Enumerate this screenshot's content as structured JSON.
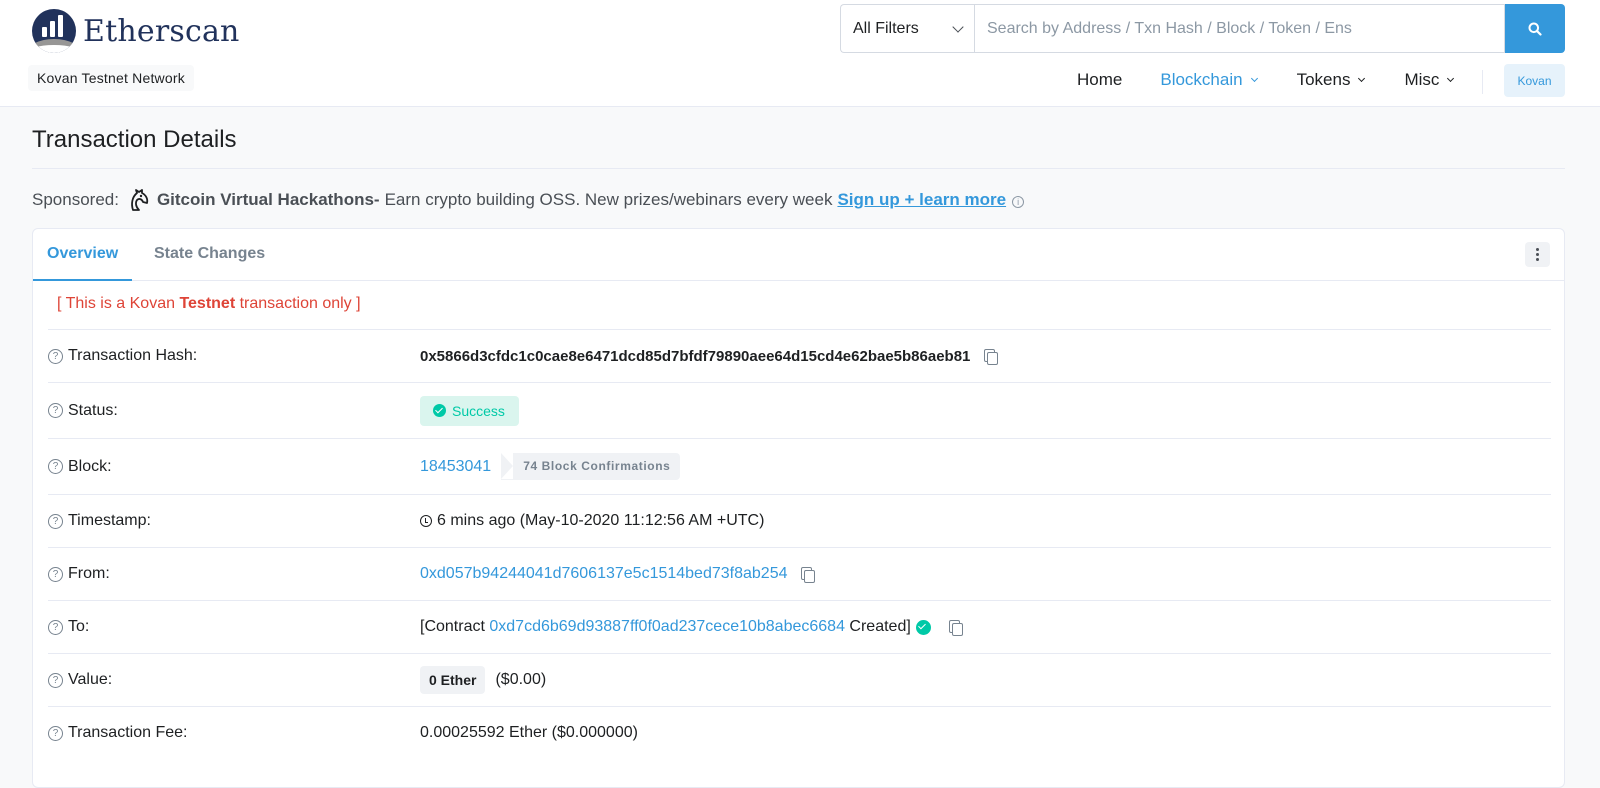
{
  "brand": {
    "name": "Etherscan",
    "network": "Kovan Testnet Network"
  },
  "search": {
    "filter": "All Filters",
    "placeholder": "Search by Address / Txn Hash / Block / Token / Ens"
  },
  "nav": {
    "home": "Home",
    "blockchain": "Blockchain",
    "tokens": "Tokens",
    "misc": "Misc",
    "network_button": "Kovan"
  },
  "page": {
    "title": "Transaction Details"
  },
  "sponsor": {
    "label": "Sponsored:",
    "name": "Gitcoin Virtual Hackathons-",
    "text": "Earn crypto building OSS. New prizes/webinars every week",
    "link": "Sign up + learn more",
    "info": "i"
  },
  "tabs": {
    "overview": "Overview",
    "state_changes": "State Changes"
  },
  "notice": {
    "prefix": "[ This is a Kovan",
    "bold": "Testnet",
    "suffix": "transaction only ]"
  },
  "details": {
    "tx_hash": {
      "label": "Transaction Hash:",
      "value": "0x5866d3cfdc1c0cae8e6471dcd85d7bfdf79890aee64d15cd4e62bae5b86aeb81"
    },
    "status": {
      "label": "Status:",
      "value": "Success"
    },
    "block": {
      "label": "Block:",
      "value": "18453041",
      "confirmations": "74 Block Confirmations"
    },
    "timestamp": {
      "label": "Timestamp:",
      "value": "6 mins ago (May-10-2020 11:12:56 AM +UTC)"
    },
    "from": {
      "label": "From:",
      "value": "0xd057b94244041d7606137e5c1514bed73f8ab254"
    },
    "to": {
      "label": "To:",
      "prefix": "[Contract",
      "address": "0xd7cd6b69d93887ff0f0ad237cece10b8abec6684",
      "suffix": "Created]"
    },
    "value": {
      "label": "Value:",
      "ether": "0 Ether",
      "usd": "($0.00)"
    },
    "fee": {
      "label": "Transaction Fee:",
      "value": "0.00025592 Ether ($0.000000)"
    }
  },
  "help_icon_glyph": "?",
  "colors": {
    "accent": "#3498db",
    "success": "#00c9a7",
    "danger": "#de4437",
    "brand": "#21325b"
  }
}
